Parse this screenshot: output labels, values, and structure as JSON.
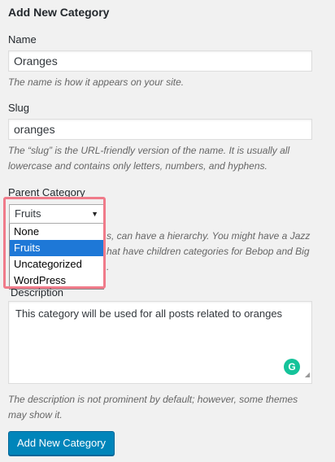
{
  "form": {
    "title": "Add New Category",
    "name": {
      "label": "Name",
      "value": "Oranges",
      "help": "The name is how it appears on your site."
    },
    "slug": {
      "label": "Slug",
      "value": "oranges",
      "help_line1": "The “slug” is the URL-friendly version of the name. It is usually all",
      "help_line2": "lowercase and contains only letters, numbers, and hyphens."
    },
    "parent": {
      "label": "Parent Category",
      "selected": "Fruits",
      "options": [
        "None",
        "Fruits",
        "Uncategorized",
        "WordPress"
      ],
      "help_line1_visible": "s, can have a hierarchy. You might have a Jazz",
      "help_line2_visible": "hat have children categories for Bebop and Big",
      "help_line3_visible": "."
    },
    "description": {
      "label": "Description",
      "value": "This category will be used for all posts related to oranges",
      "help_line1": "The description is not prominent by default; however, some themes",
      "help_line2": "may show it."
    },
    "submit_label": "Add New Category"
  },
  "colors": {
    "primary_button": "#0085ba",
    "selected_option": "#1e78d7",
    "highlight_border": "#f07b8a",
    "grammarly": "#15c39a"
  }
}
